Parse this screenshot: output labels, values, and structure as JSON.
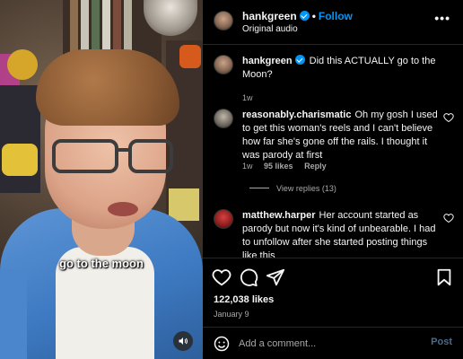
{
  "video": {
    "caption": "go to the moon"
  },
  "header": {
    "username": "hankgreen",
    "separator": "•",
    "follow_label": "Follow",
    "audio": "Original audio",
    "more_label": "•••"
  },
  "comments": [
    {
      "username": "hankgreen",
      "text": "Did this ACTUALLY go to the Moon?",
      "time": "1w",
      "verified": true
    },
    {
      "username": "reasonably.charismatic",
      "text": "Oh my gosh I used to get this woman's reels and I can't believe how far she's gone off the rails. I thought it was parody at first",
      "time": "1w",
      "likes": "95 likes",
      "reply_label": "Reply",
      "view_replies": "View replies (13)"
    },
    {
      "username": "matthew.harper",
      "text": "Her account started as parody but now it's kind of unbearable. I had to unfollow after she started posting things like this"
    }
  ],
  "post": {
    "likes": "122,038 likes",
    "date": "January 9"
  },
  "comment_box": {
    "placeholder": "Add a comment...",
    "post_label": "Post"
  },
  "colors": {
    "accent": "#0095f6",
    "background": "#000000",
    "muted_text": "#a8a8a8"
  },
  "icons": [
    "heart-icon",
    "comment-icon",
    "share-icon",
    "bookmark-icon",
    "emoji-icon",
    "sound-icon",
    "verified-badge-icon"
  ]
}
